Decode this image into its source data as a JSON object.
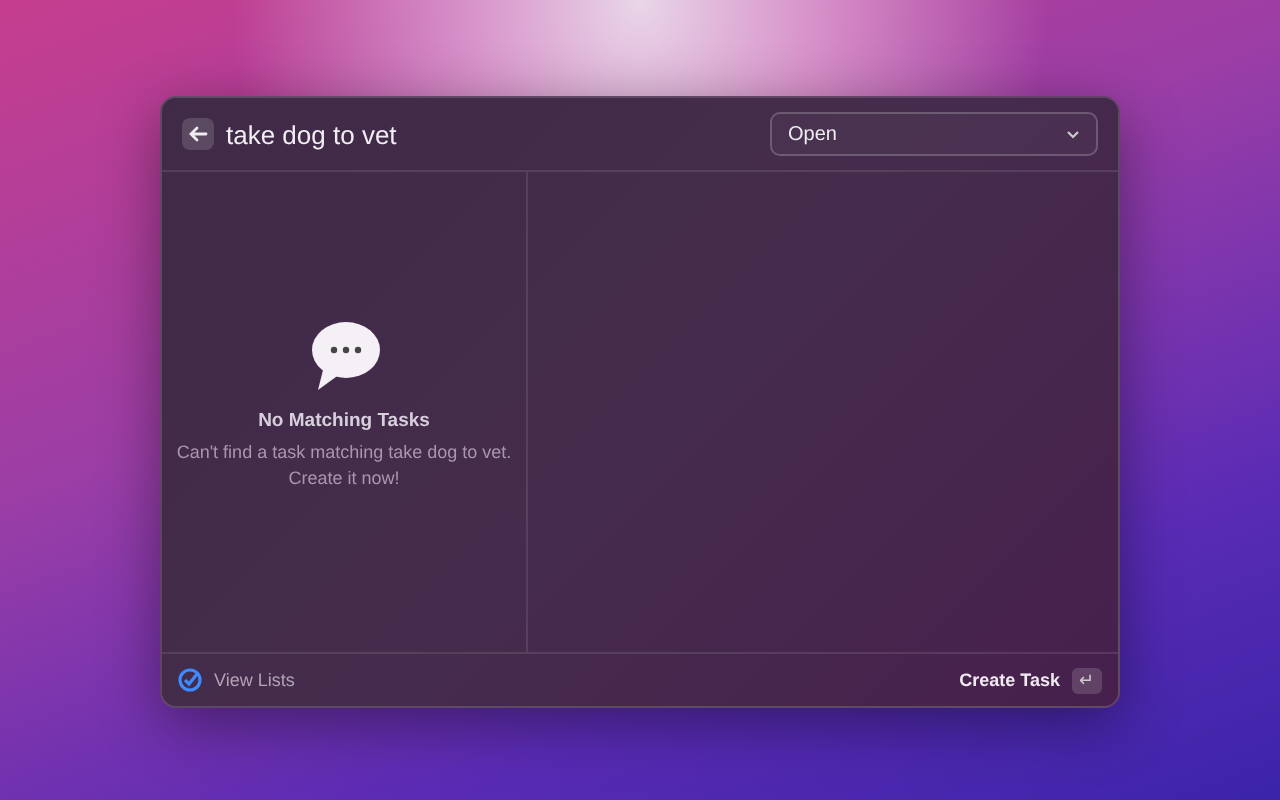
{
  "search": {
    "value": "take dog to vet"
  },
  "filter": {
    "value": "Open"
  },
  "empty_state": {
    "title": "No Matching Tasks",
    "message": "Can't find a task matching take dog to vet. Create it now!"
  },
  "footer": {
    "left_action": "View Lists",
    "primary_action": "Create Task",
    "shortcut_key": "↵"
  }
}
